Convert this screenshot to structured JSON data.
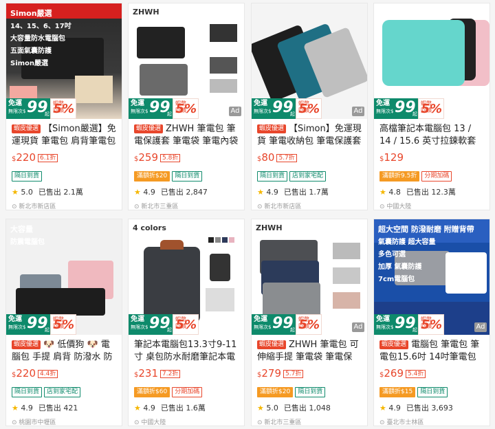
{
  "common": {
    "free_l1": "免運",
    "free_l2": "無限次$",
    "free_big": "99",
    "free_qi": "起",
    "coin_l1": "蝦幣",
    "coin_l2": "回饋",
    "coin_pct": "5%",
    "ad": "Ad",
    "star": "★",
    "pin": "⊙",
    "sold_prefix": "已售出",
    "currency": "$"
  },
  "products": [
    {
      "image_texts": [
        "Simon嚴選",
        "14、15、6、17吋",
        "大容量防水電腦包",
        "五面氣囊防護",
        "Simon嚴選"
      ],
      "badge": "蝦皮優選",
      "title": "【Simon嚴選】免運現貨 筆電包 肩背筆電包 ...",
      "price": "220",
      "discount": "6.1折",
      "tags": [
        {
          "text": "隔日到貨",
          "style": "green"
        }
      ],
      "rating": "5.0",
      "sold": "2.1萬",
      "location": "新北市新店區",
      "ad": false
    },
    {
      "image_texts": [
        "ZHWH"
      ],
      "badge": "蝦皮優選",
      "title": "ZHWH 筆電包 筆電保護套 筆電袋 筆電內袋 ...",
      "price": "259",
      "discount": "5.8折",
      "tags": [
        {
          "text": "滿額折$20",
          "style": "orange"
        },
        {
          "text": "隔日到貨",
          "style": "green"
        }
      ],
      "rating": "4.9",
      "sold": "2,847",
      "location": "新北市三重區",
      "ad": true
    },
    {
      "image_texts": [],
      "badge": "蝦皮優選",
      "title": "【Simon】免運現貨 筆電收納包 筆電保護套 ...",
      "price": "80",
      "discount": "5.7折",
      "tags": [
        {
          "text": "隔日到貨",
          "style": "green"
        },
        {
          "text": "店到家宅配",
          "style": "green"
        }
      ],
      "rating": "4.9",
      "sold": "1.7萬",
      "location": "新北市新店區",
      "ad": true
    },
    {
      "image_texts": [],
      "badge": "",
      "title": "高檔筆記本電腦包 13 / 14 / 15.6 英寸拉鍊軟套",
      "price": "129",
      "discount": "",
      "tags": [
        {
          "text": "滿額折9.5折",
          "style": "orange"
        },
        {
          "text": "分期加碼",
          "style": "red"
        }
      ],
      "rating": "4.8",
      "sold": "12.3萬",
      "location": "中國大陸",
      "ad": false
    },
    {
      "image_texts": [
        "大容量",
        "防震電腦包"
      ],
      "badge": "蝦皮優選",
      "title": "🐶 低價狗 🐶 電腦包 手提 肩背 防潑水 防震 氣...",
      "price": "220",
      "discount": "4.4折",
      "tags": [
        {
          "text": "隔日到貨",
          "style": "green"
        },
        {
          "text": "店到家宅配",
          "style": "green"
        }
      ],
      "rating": "4.9",
      "sold": "421",
      "location": "桃園市中壢區",
      "ad": false
    },
    {
      "image_texts": [
        "4 colors"
      ],
      "badge": "",
      "title": "筆記本電腦包13.3寸9-11寸 桌包防水耐磨筆記本電腦...",
      "price": "231",
      "discount": "7.2折",
      "tags": [
        {
          "text": "滿額折$60",
          "style": "orange"
        },
        {
          "text": "分期加碼",
          "style": "red"
        }
      ],
      "rating": "4.9",
      "sold": "1.6萬",
      "location": "中國大陸",
      "ad": false
    },
    {
      "image_texts": [
        "ZHWH"
      ],
      "badge": "蝦皮優選",
      "title": "ZHWH 筆電包 可伸縮手提 筆電袋 筆電保護...",
      "price": "279",
      "discount": "5.7折",
      "tags": [
        {
          "text": "滿額折$20",
          "style": "orange"
        },
        {
          "text": "隔日到貨",
          "style": "green"
        }
      ],
      "rating": "5.0",
      "sold": "1,048",
      "location": "新北市三重區",
      "ad": true
    },
    {
      "image_texts": [
        "超大空間 防潑耐磨 附贈背帶",
        "氣囊防護 超大容量",
        "多色可選",
        "加厚 氣囊防護",
        "7cm電腦包"
      ],
      "badge": "蝦皮優選",
      "title": "電腦包 筆電包 筆電包15.6吋 14吋筆電包 手...",
      "price": "269",
      "discount": "5.4折",
      "tags": [
        {
          "text": "滿額折$15",
          "style": "orange"
        },
        {
          "text": "隔日到貨",
          "style": "green"
        }
      ],
      "rating": "4.9",
      "sold": "3,693",
      "location": "臺北市士林區",
      "ad": true
    }
  ],
  "colors": {
    "accent": "#e8462b",
    "green": "#0e8a6b",
    "orange": "#f59a23"
  }
}
